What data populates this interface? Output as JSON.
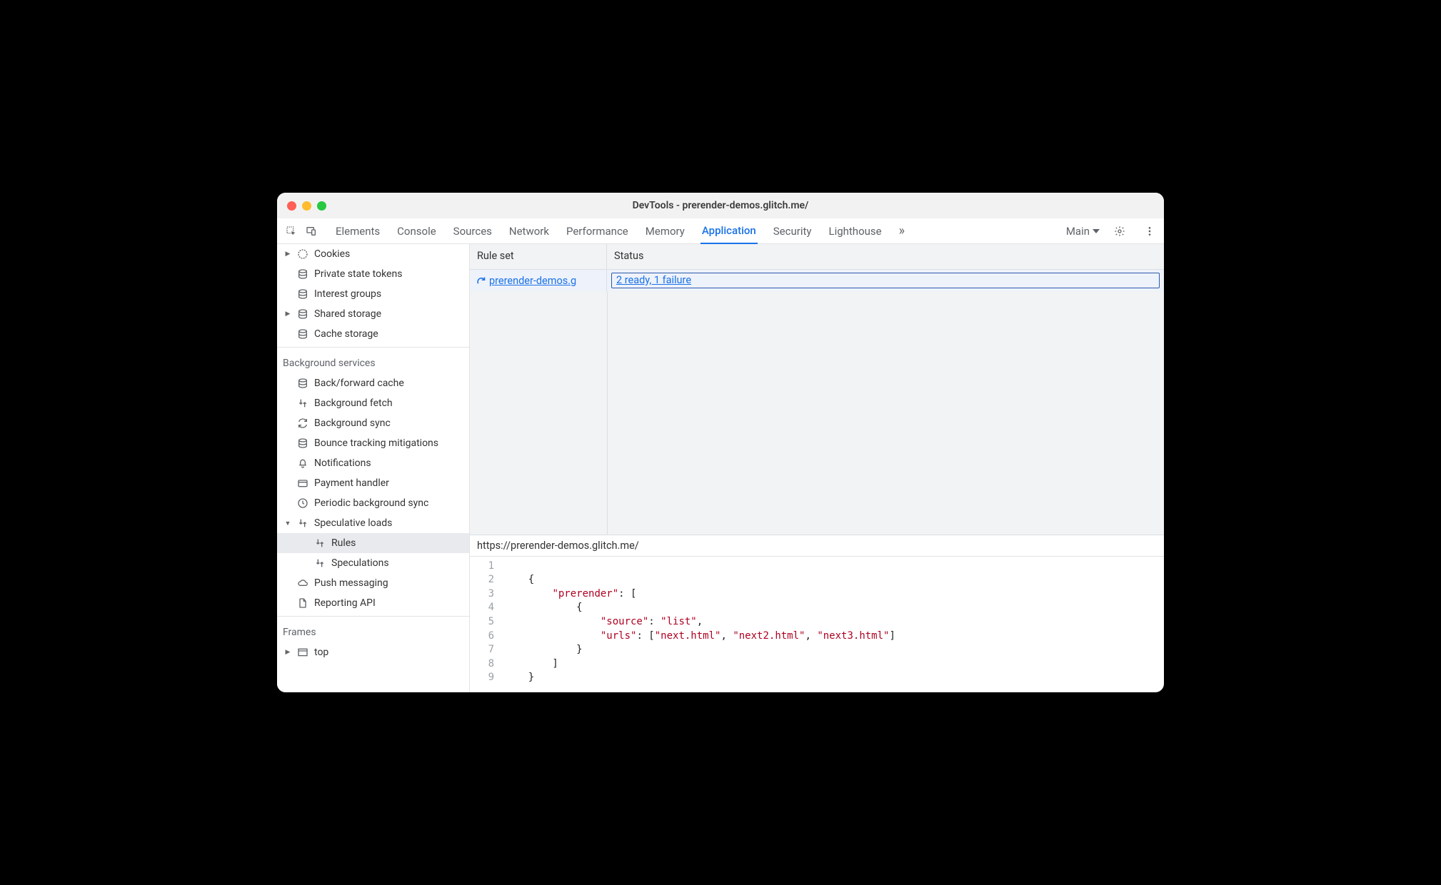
{
  "window": {
    "title": "DevTools - prerender-demos.glitch.me/"
  },
  "toolbar": {
    "tabs": [
      "Elements",
      "Console",
      "Sources",
      "Network",
      "Performance",
      "Memory",
      "Application",
      "Security",
      "Lighthouse"
    ],
    "active_tab": "Application",
    "frame_label": "Main"
  },
  "sidebar": {
    "storage": {
      "cookies": "Cookies",
      "private_state_tokens": "Private state tokens",
      "interest_groups": "Interest groups",
      "shared_storage": "Shared storage",
      "cache_storage": "Cache storage"
    },
    "bg_section": "Background services",
    "bg": {
      "bf_cache": "Back/forward cache",
      "bg_fetch": "Background fetch",
      "bg_sync": "Background sync",
      "bounce": "Bounce tracking mitigations",
      "notifications": "Notifications",
      "payment": "Payment handler",
      "periodic": "Periodic background sync",
      "speculative": "Speculative loads",
      "rules": "Rules",
      "speculations": "Speculations",
      "push": "Push messaging",
      "reporting": "Reporting API"
    },
    "frames_section": "Frames",
    "frames": {
      "top": "top"
    }
  },
  "grid": {
    "col_ruleset": "Rule set",
    "col_status": "Status",
    "row0": {
      "ruleset_label": " prerender-demos.g",
      "status_label": "2 ready, 1 failure"
    }
  },
  "detail": {
    "url": "https://prerender-demos.glitch.me/",
    "lines": [
      "1",
      "2",
      "3",
      "4",
      "5",
      "6",
      "7",
      "8",
      "9"
    ],
    "json": {
      "key_prerender": "\"prerender\"",
      "key_source": "\"source\"",
      "key_urls": "\"urls\"",
      "val_list": "\"list\"",
      "url0": "\"next.html\"",
      "url1": "\"next2.html\"",
      "url2": "\"next3.html\""
    }
  }
}
